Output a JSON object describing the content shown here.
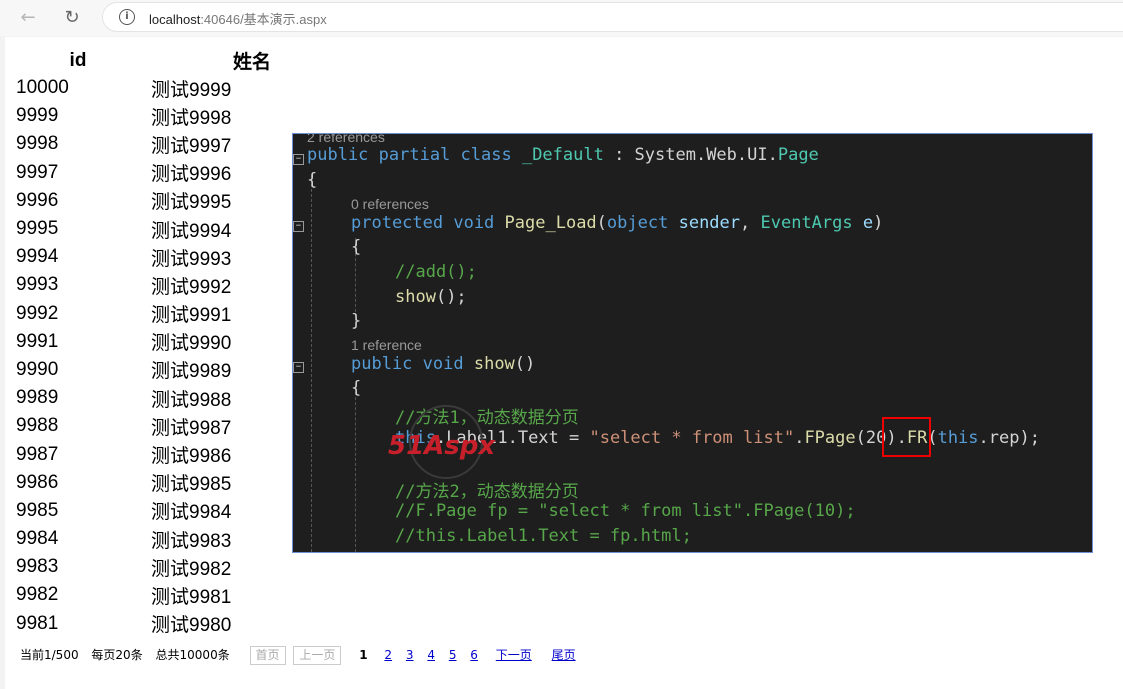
{
  "browser": {
    "url_host": "localhost",
    "url_rest": ":40646/基本演示.aspx"
  },
  "table": {
    "headers": [
      "id",
      "姓名"
    ],
    "rows": [
      [
        "10000",
        "测试9999"
      ],
      [
        "9999",
        "测试9998"
      ],
      [
        "9998",
        "测试9997"
      ],
      [
        "9997",
        "测试9996"
      ],
      [
        "9996",
        "测试9995"
      ],
      [
        "9995",
        "测试9994"
      ],
      [
        "9994",
        "测试9993"
      ],
      [
        "9993",
        "测试9992"
      ],
      [
        "9992",
        "测试9991"
      ],
      [
        "9991",
        "测试9990"
      ],
      [
        "9990",
        "测试9989"
      ],
      [
        "9989",
        "测试9988"
      ],
      [
        "9988",
        "测试9987"
      ],
      [
        "9987",
        "测试9986"
      ],
      [
        "9986",
        "测试9985"
      ],
      [
        "9985",
        "测试9984"
      ],
      [
        "9984",
        "测试9983"
      ],
      [
        "9983",
        "测试9982"
      ],
      [
        "9982",
        "测试9981"
      ],
      [
        "9981",
        "测试9980"
      ]
    ]
  },
  "pager": {
    "current": "当前1/500",
    "per_page": "每页20条",
    "total": "总共10000条",
    "first": "首页",
    "prev": "上一页",
    "pages": [
      "1",
      "2",
      "3",
      "4",
      "5",
      "6"
    ],
    "next": "下一页",
    "last": "尾页"
  },
  "code": {
    "ref_class": "2 references",
    "ref_load": "0 references",
    "ref_show": "1 reference",
    "comment_add": "//add();",
    "comment_m1": "//方法1，动态数据分页",
    "comment_m2": "//方法2，动态数据分页",
    "comment_fp": "//F.Page fp = \"select * from list\".FPage(10);",
    "comment_label": "//this.Label1.Text = fp.html;",
    "sql": "\"select * from list\"",
    "page_size": "20"
  },
  "watermark": {
    "text": "51Aspx"
  }
}
